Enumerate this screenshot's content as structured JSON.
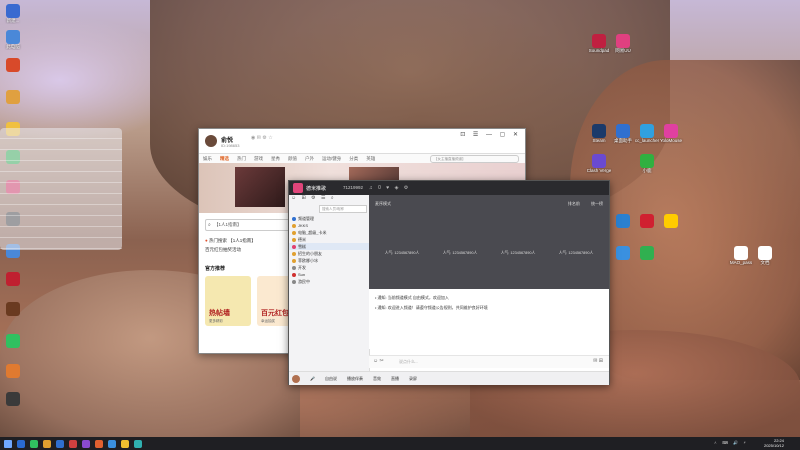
{
  "desktop": {
    "left_icons": [
      {
        "label": "新建...",
        "color": "#3a6ad0"
      },
      {
        "label": "此电脑",
        "color": "#4a88d8"
      },
      {
        "label": "",
        "color": "#d84a2a"
      },
      {
        "label": "",
        "color": "#e0a040"
      },
      {
        "label": "",
        "color": "#f0c040"
      },
      {
        "label": "",
        "color": "#30b050"
      },
      {
        "label": "",
        "color": "#d83060"
      },
      {
        "label": "",
        "color": "#404040"
      },
      {
        "label": "",
        "color": "#4a88d8"
      },
      {
        "label": "",
        "color": "#c02030"
      },
      {
        "label": "",
        "color": "#6a3a20"
      },
      {
        "label": "",
        "color": "#30c060"
      },
      {
        "label": "",
        "color": "#e07a30"
      },
      {
        "label": "",
        "color": "#3a3a3a"
      }
    ],
    "right_icons": [
      {
        "label": "Soundpad",
        "color": "#c02040"
      },
      {
        "label": "网易UU",
        "color": "#e04080"
      },
      {
        "label": "Steam",
        "color": "#1b3a6a"
      },
      {
        "label": "桌面助手",
        "color": "#3070d0"
      },
      {
        "label": "cc_launcher",
        "color": "#30a0e0"
      },
      {
        "label": "YoloMouse",
        "color": "#e040a0"
      },
      {
        "label": "Clash Verge",
        "color": "#6a4ad0"
      },
      {
        "label": "小鹿",
        "color": "#30b040"
      },
      {
        "label": "",
        "color": "#2a80d0"
      },
      {
        "label": "",
        "color": "#d02030"
      },
      {
        "label": "",
        "color": "#ffcc00"
      },
      {
        "label": "",
        "color": "#30b050"
      },
      {
        "label": "",
        "color": "#3a90e0"
      },
      {
        "label": "MAO_pass",
        "color": "#ffffff"
      },
      {
        "label": "文档",
        "color": "#ffffff"
      }
    ]
  },
  "win1": {
    "username": "俞悦",
    "uid": "ID:198653",
    "window_controls": "⊡ ☰ — ▢ ✕",
    "nav": [
      "娱乐",
      "精选",
      "热门",
      "游戏",
      "星秀",
      "颜值",
      "户外",
      "运动/健身",
      "分类",
      "英雄"
    ],
    "nav_search": "【女主播直播频道】",
    "search_placeholder": "【1人1指南】",
    "hot_title": "热门搜索",
    "hot_item": "【1人1指南】",
    "hot_line2": "百元红包抽奖活动",
    "section": "官方推荐",
    "cards": [
      {
        "title": "热帖墙",
        "sub": "更多精彩",
        "bg": "#f5e8b0"
      },
      {
        "title": "百元红包",
        "sub": "幸运抽奖",
        "bg": "#fbe9d0"
      }
    ]
  },
  "win2": {
    "title": "德米推歌",
    "room_id": "71219992",
    "sidebar_filter": "搜索人员/昵称",
    "sidebar_rows": [
      {
        "text": "频道管理",
        "color": "#3070d0",
        "sel": false
      },
      {
        "text": "JKKS",
        "color": "#e0a030",
        "sel": false
      },
      {
        "text": "电脑_超级_卡米",
        "color": "#e0a030",
        "sel": false
      },
      {
        "text": "德米",
        "color": "#e0a030",
        "sel": false
      },
      {
        "text": "雪糕",
        "color": "#e04070",
        "sel": true
      },
      {
        "text": "招生的小朋友",
        "color": "#e0a030",
        "sel": false
      },
      {
        "text": "菲欧娜小冰",
        "color": "#e0a030",
        "sel": false
      },
      {
        "text": "开发",
        "color": "#888888",
        "sel": false
      },
      {
        "text": "Sun",
        "color": "#d03030",
        "sel": false
      },
      {
        "text": "游民中",
        "color": "#888888",
        "sel": false
      }
    ],
    "stage_left": "麦序模式",
    "stage_tabs": [
      "排名前 ",
      "统一榜"
    ],
    "slots": [
      "人气: 1234567890人",
      "人气: 1234567890人",
      "人气: 1234567890人",
      "人气: 1234567890人"
    ],
    "messages": [
      "• 通知: 当前频道模式 自由模式，欢迎加入",
      "• 通知: 欢迎进入频道！请遵守频道公告规则，共同维护良好环境"
    ],
    "input_placeholder": "说点什么...",
    "bottom": [
      "自由说",
      "播放伴奏",
      "音效",
      "直播",
      "录屏"
    ]
  },
  "taskbar": {
    "apps": [
      "#2a6ad0",
      "#30c060",
      "#e0a030",
      "#3070d0",
      "#d04040",
      "#8a4ad0",
      "#e06030",
      "#3a90e0",
      "#f0c030",
      "#30b0b0"
    ],
    "tray": "ㅅ ⌨ 🔊 ⚡",
    "time": "22:24",
    "date": "2025/10/12"
  }
}
